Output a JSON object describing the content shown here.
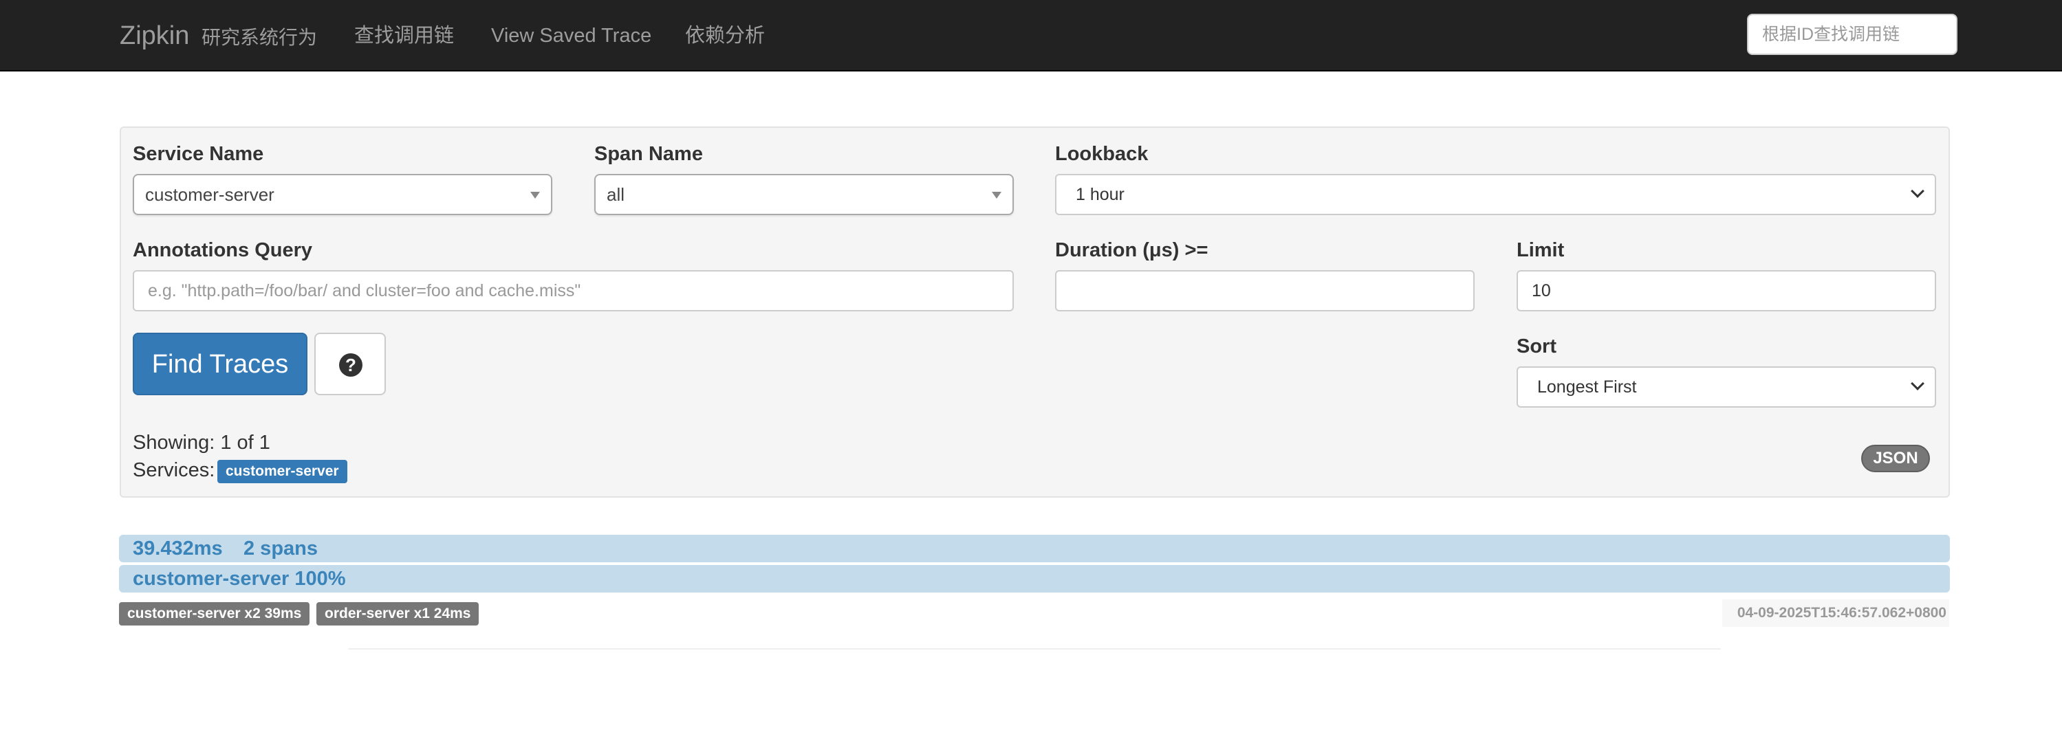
{
  "navbar": {
    "brand": "Zipkin",
    "brand_sub": "研究系统行为",
    "links": [
      "查找调用链",
      "View Saved Trace",
      "依赖分析"
    ],
    "search_placeholder": "根据ID查找调用链"
  },
  "search": {
    "service_name_label": "Service Name",
    "service_name_value": "customer-server",
    "span_name_label": "Span Name",
    "span_name_value": "all",
    "lookback_label": "Lookback",
    "lookback_value": "1 hour",
    "annotations_label": "Annotations Query",
    "annotations_placeholder": "e.g. \"http.path=/foo/bar/ and cluster=foo and cache.miss\"",
    "duration_label": "Duration (μs) >=",
    "duration_value": "",
    "limit_label": "Limit",
    "limit_value": "10",
    "sort_label": "Sort",
    "sort_value": "Longest First",
    "find_button": "Find Traces",
    "help_icon": "?"
  },
  "results": {
    "showing": "Showing: 1 of 1",
    "services_label": "Services:",
    "service_badge": "customer-server",
    "json_button": "JSON"
  },
  "trace": {
    "duration": "39.432ms",
    "spans": "2 spans",
    "service_percent": "customer-server 100%",
    "service_badges": [
      "customer-server x2 39ms",
      "order-server x1 24ms"
    ],
    "timestamp": "04-09-2025T15:46:57.062+0800",
    "colors": {
      "bar_bg": "#c3dbeb",
      "bar_text": "#3b84b9",
      "badge_gray": "#777777",
      "primary": "#337ab7"
    }
  }
}
